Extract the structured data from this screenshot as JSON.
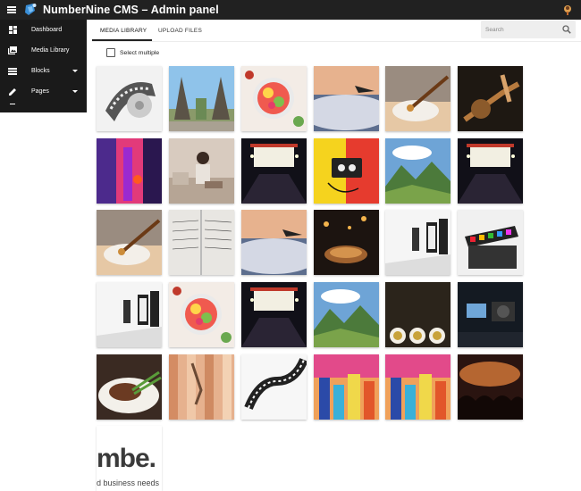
{
  "app": {
    "title": "NumberNine CMS – Admin panel",
    "colors": {
      "appbar": "#212121",
      "sidebar": "#1a1a1a"
    },
    "icons": {
      "menu": "hamburger-icon",
      "logo": "numbernine-logo-icon",
      "user": "user-avatar-icon"
    }
  },
  "sidebar": {
    "items": [
      {
        "label": "Dashboard",
        "icon": "dashboard-icon",
        "expandable": false
      },
      {
        "label": "Media Library",
        "icon": "photo-library-icon",
        "expandable": false
      },
      {
        "label": "Blocks",
        "icon": "blocks-icon",
        "expandable": true
      },
      {
        "label": "Pages",
        "icon": "pencil-icon",
        "expandable": true
      }
    ]
  },
  "tabs": [
    {
      "label": "MEDIA LIBRARY",
      "active": true
    },
    {
      "label": "UPLOAD FILES",
      "active": false
    }
  ],
  "search": {
    "placeholder": "Search",
    "value": "",
    "icon": "search-icon"
  },
  "select_multiple": {
    "label": "Select multiple",
    "checked": false
  },
  "media": {
    "rows": [
      [
        "film-reel",
        "temple-gate",
        "food-bowl",
        "airplane-sky",
        "paint-brush",
        "guitar-player"
      ],
      [
        "pink-neon-lights",
        "woman-sofa",
        "stage-screen",
        "cassette-yellow",
        "mountain-valley",
        "stage-screen"
      ],
      [
        "paint-brush",
        "sheet-music",
        "airplane-sky",
        "street-food-night",
        "gallery-frames",
        "clapperboard"
      ],
      [
        "gallery-frames",
        "food-bowl",
        "stage-screen",
        "mountain-valley",
        "three-icons",
        "camera-studio"
      ],
      [
        "steak-plate",
        "wooden-fence-hand",
        "film-reel-white",
        "colorful-city",
        "colorful-city",
        "concert-crowd"
      ],
      [
        "numbernine-logo"
      ]
    ],
    "logo_caption": {
      "text_large": "mbe.",
      "text_small": "d business needs"
    }
  }
}
